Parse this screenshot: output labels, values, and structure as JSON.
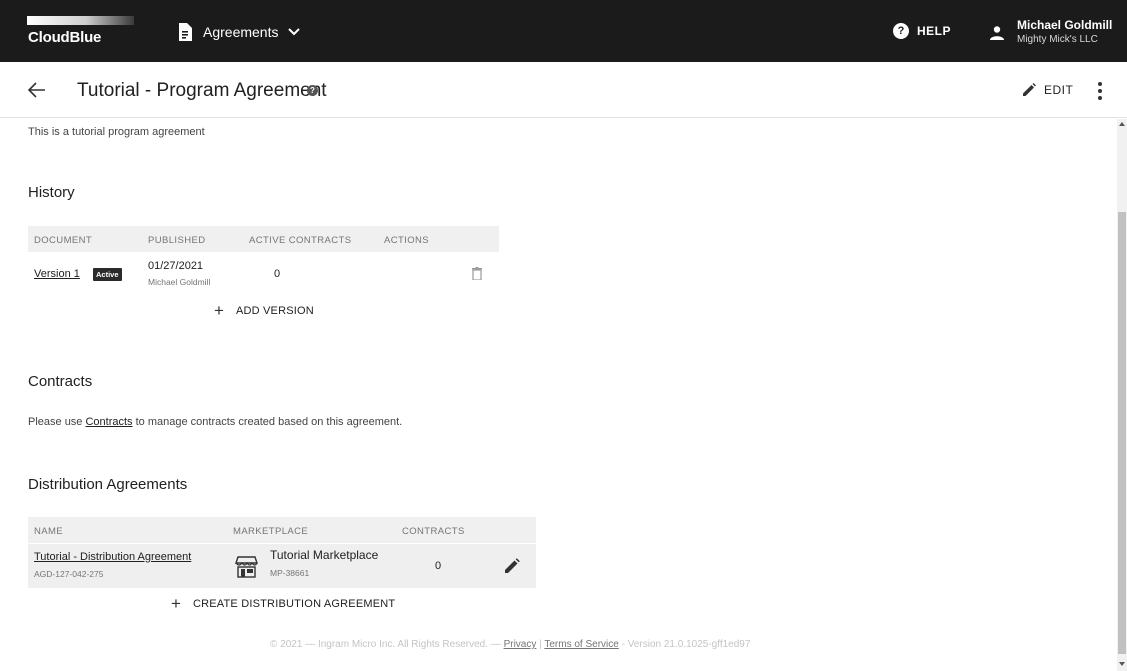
{
  "topbar": {
    "logo_text": "CloudBlue",
    "module_label": "Agreements",
    "help_label": "HELP",
    "user_name": "Michael Goldmill",
    "user_org": "Mighty Mick's LLC",
    "icons": [
      "document-icon",
      "chevron-down-icon",
      "help-icon",
      "person-icon"
    ]
  },
  "header": {
    "title": "Tutorial - Program Agreement",
    "info_glyph": "?",
    "edit_label": "EDIT"
  },
  "description": "This is a tutorial program agreement",
  "history": {
    "title": "History",
    "columns": [
      "DOCUMENT",
      "PUBLISHED",
      "ACTIVE CONTRACTS",
      "ACTIONS"
    ],
    "rows": [
      {
        "document": "Version 1",
        "badge": "Active",
        "published_date": "01/27/2021",
        "published_by": "Michael Goldmill",
        "active_contracts": "0"
      }
    ],
    "add_label": "ADD VERSION"
  },
  "contracts": {
    "title": "Contracts",
    "text_before": "Please use ",
    "link": "Contracts",
    "text_after": " to manage contracts created based on this agreement."
  },
  "distribution": {
    "title": "Distribution Agreements",
    "columns": [
      "NAME",
      "MARKETPLACE",
      "CONTRACTS"
    ],
    "rows": [
      {
        "name": "Tutorial - Distribution Agreement",
        "id": "AGD-127-042-275",
        "marketplace": "Tutorial Marketplace",
        "marketplace_id": "MP-38661",
        "contracts": "0"
      }
    ],
    "create_label": "CREATE DISTRIBUTION AGREEMENT"
  },
  "footer": {
    "copyright": "© 2021 — Ingram Micro Inc. All Rights Reserved. — ",
    "privacy": "Privacy",
    "separator": " | ",
    "terms": "Terms of Service",
    "version": " - Version 21.0.1025-gff1ed97"
  },
  "colors": {
    "topbar_bg": "#1b1b1b",
    "table_header_bg": "#f0f0f0",
    "badge_bg": "#2b2b2b"
  }
}
